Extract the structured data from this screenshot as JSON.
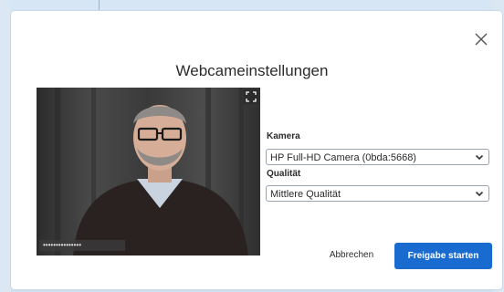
{
  "dialog": {
    "title": "Webcameinstellungen",
    "camera_label": "Kamera",
    "camera_value": "HP Full-HD Camera (0bda:5668)",
    "quality_label": "Qualität",
    "quality_value": "Mittlere Qualität",
    "cancel_label": "Abbrechen",
    "start_label": "Freigabe starten",
    "name_tag": "•••••••••••••••"
  },
  "colors": {
    "primary": "#1a6bd0",
    "background": "#cfe1f1"
  },
  "icons": [
    "close-icon",
    "expand-icon",
    "chevron-down-icon"
  ]
}
